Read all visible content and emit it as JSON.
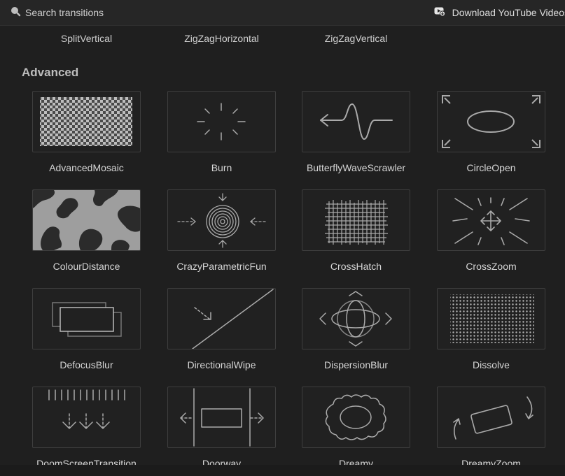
{
  "search": {
    "placeholder": "Search transitions",
    "icon": "search-icon"
  },
  "download": {
    "label": "Download YouTube Videos",
    "icon": "youtube-download-icon"
  },
  "previous_section": {
    "items": [
      "SplitVertical",
      "ZigZagHorizontal",
      "ZigZagVertical"
    ]
  },
  "section": {
    "title": "Advanced"
  },
  "transitions": [
    {
      "name": "AdvancedMosaic",
      "icon": "mosaic-checker-icon"
    },
    {
      "name": "Burn",
      "icon": "burst-rays-icon"
    },
    {
      "name": "ButterflyWaveScrawler",
      "icon": "wave-arrow-icon"
    },
    {
      "name": "CircleOpen",
      "icon": "ellipse-corners-icon"
    },
    {
      "name": "ColourDistance",
      "icon": "blob-pattern-icon"
    },
    {
      "name": "CrazyParametricFun",
      "icon": "concentric-target-icon"
    },
    {
      "name": "CrossHatch",
      "icon": "crosshatch-grid-icon"
    },
    {
      "name": "CrossZoom",
      "icon": "zoom-burst-icon"
    },
    {
      "name": "DefocusBlur",
      "icon": "offset-rectangles-icon"
    },
    {
      "name": "DirectionalWipe",
      "icon": "diagonal-wipe-icon"
    },
    {
      "name": "DispersionBlur",
      "icon": "petal-circles-icon"
    },
    {
      "name": "Dissolve",
      "icon": "dot-grid-icon"
    },
    {
      "name": "DoomScreenTransition",
      "icon": "drip-arrows-icon"
    },
    {
      "name": "Doorway",
      "icon": "doorway-arrows-icon"
    },
    {
      "name": "Dreamy",
      "icon": "cloud-ellipse-icon"
    },
    {
      "name": "DreamyZoom",
      "icon": "rotate-card-icon"
    }
  ]
}
